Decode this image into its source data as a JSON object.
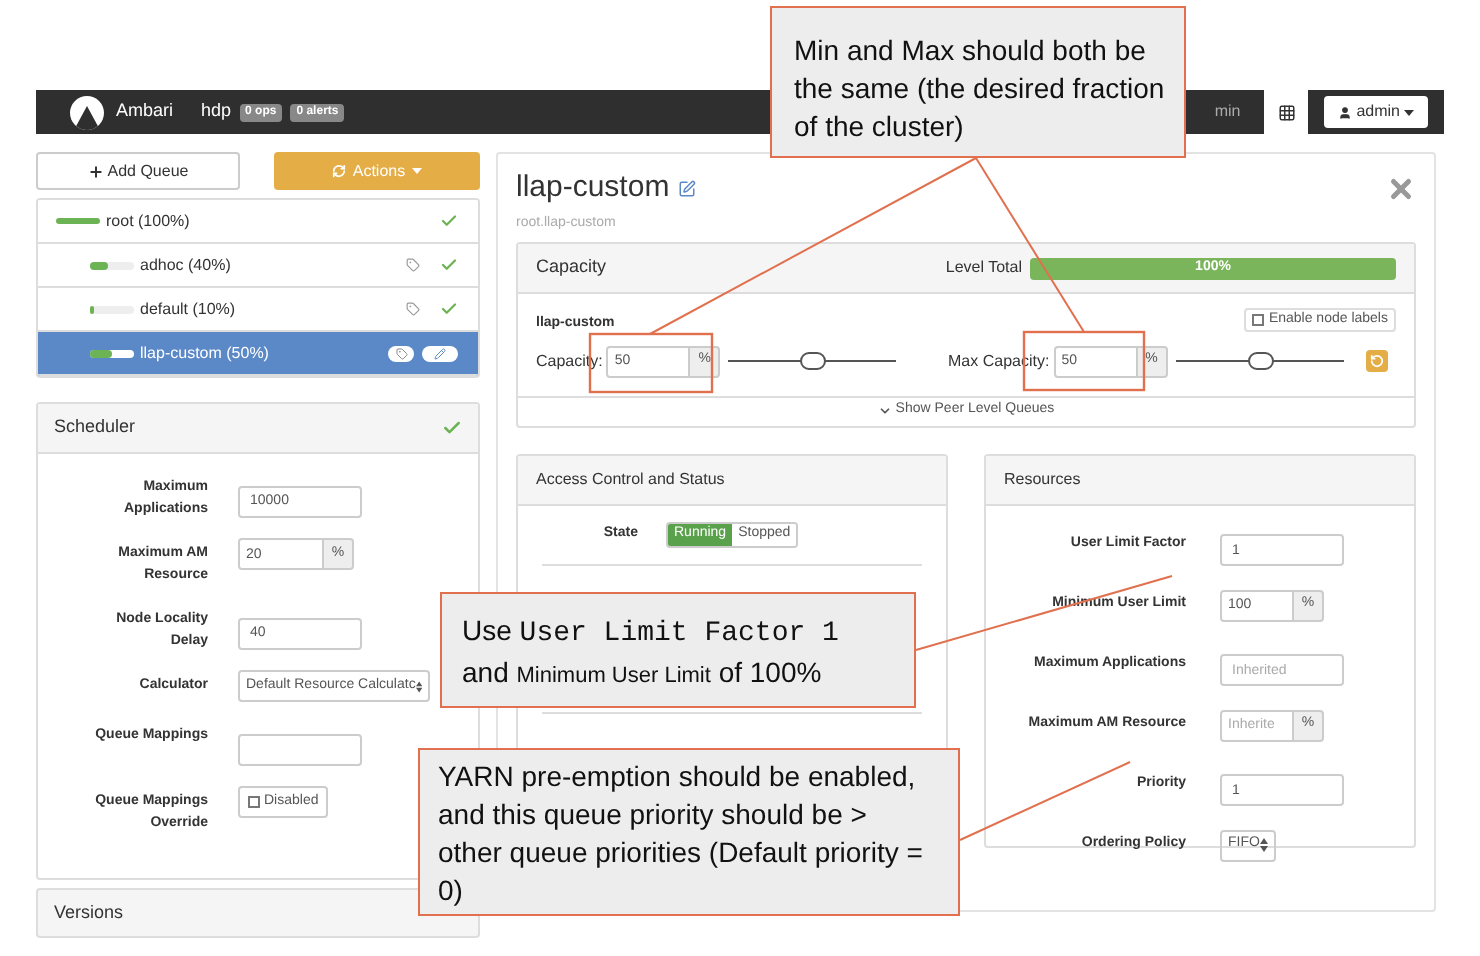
{
  "navbar": {
    "brand": "Ambari",
    "cluster": "hdp",
    "badges": [
      "0 ops",
      "0 alerts"
    ],
    "admin_link": "min",
    "user": "admin"
  },
  "toolbar": {
    "add_button": "Add Queue",
    "actions_button": "Actions"
  },
  "queues": [
    {
      "label": "root (100%)",
      "level": 1,
      "selected": false,
      "children": [
        {
          "label": "adhoc (40%)",
          "level": 0.4,
          "selected": false
        },
        {
          "label": "default (10%)",
          "level": 0.1,
          "selected": false
        },
        {
          "label": "llap-custom (50%)",
          "level": 0.5,
          "selected": true
        }
      ]
    }
  ],
  "scheduler": {
    "title": "Scheduler",
    "fields": [
      {
        "kind": "input",
        "label": "Maximum Applications",
        "value": "10000"
      },
      {
        "kind": "unit",
        "label": "Maximum AM Resource",
        "value": "20",
        "unit": "%"
      },
      {
        "kind": "input",
        "label": "Node Locality Delay",
        "value": "40"
      },
      {
        "kind": "select",
        "label": "Calculator",
        "value": "Default Resource Calculatc"
      },
      {
        "kind": "input",
        "label": "Queue Mappings"
      },
      {
        "kind": "checkbox",
        "label": "Queue Mappings Override",
        "text": "Disabled",
        "checked": false
      }
    ]
  },
  "versions": {
    "title": "Versions"
  },
  "queue": {
    "title": "llap-custom",
    "path": "root.llap-custom"
  },
  "capacity": {
    "title": "Capacity",
    "total_label": "Level Total",
    "total": {
      "text": "100%",
      "level": 1
    },
    "queue_name": "llap-custom",
    "node_labels": {
      "label": "Enable node labels",
      "checked": false
    },
    "sliders": [
      {
        "label": "Capacity:",
        "value": "50",
        "unit": "%",
        "level": 0.5
      },
      {
        "label": "Max Capacity:",
        "value": "50",
        "unit": "%",
        "level": 0.5
      }
    ],
    "peer_link": "Show Peer Level Queues"
  },
  "access": {
    "title": "Access Control and Status",
    "state_label": "State",
    "states": [
      {
        "label": "Running",
        "selected": true
      },
      {
        "label": "Stopped",
        "selected": false
      }
    ]
  },
  "resources": {
    "title": "Resources",
    "fields": [
      {
        "kind": "input",
        "label": "User Limit Factor",
        "value": "1"
      },
      {
        "kind": "unit",
        "label": "Minimum User Limit",
        "value": "100",
        "unit": "%"
      },
      {
        "kind": "input",
        "label": "Maximum Applications",
        "placeholder": "Inherited"
      },
      {
        "kind": "unit",
        "label": "Maximum AM Resource",
        "placeholder": "Inherite",
        "unit": "%"
      },
      {
        "kind": "input",
        "label": "Priority",
        "value": "1"
      },
      {
        "kind": "select",
        "label": "Ordering Policy",
        "value": "FIFO"
      }
    ]
  },
  "callouts": [
    {
      "parts": [
        {
          "kind": "plain",
          "text": "Min and Max should both be the same (the desired fraction of the cluster)"
        }
      ]
    },
    {
      "parts": [
        {
          "kind": "plain",
          "text": "Use "
        },
        {
          "kind": "code",
          "text": "User Limit Factor 1"
        },
        {
          "kind": "plain",
          "text": " and "
        },
        {
          "kind": "small",
          "text": "Minimum User Limit"
        },
        {
          "kind": "plain",
          "text": " of 100%"
        }
      ]
    },
    {
      "parts": [
        {
          "kind": "plain",
          "text": "YARN pre-emption should be enabled, and this queue priority should be > other queue priorities (Default priority = 0)"
        }
      ]
    }
  ]
}
